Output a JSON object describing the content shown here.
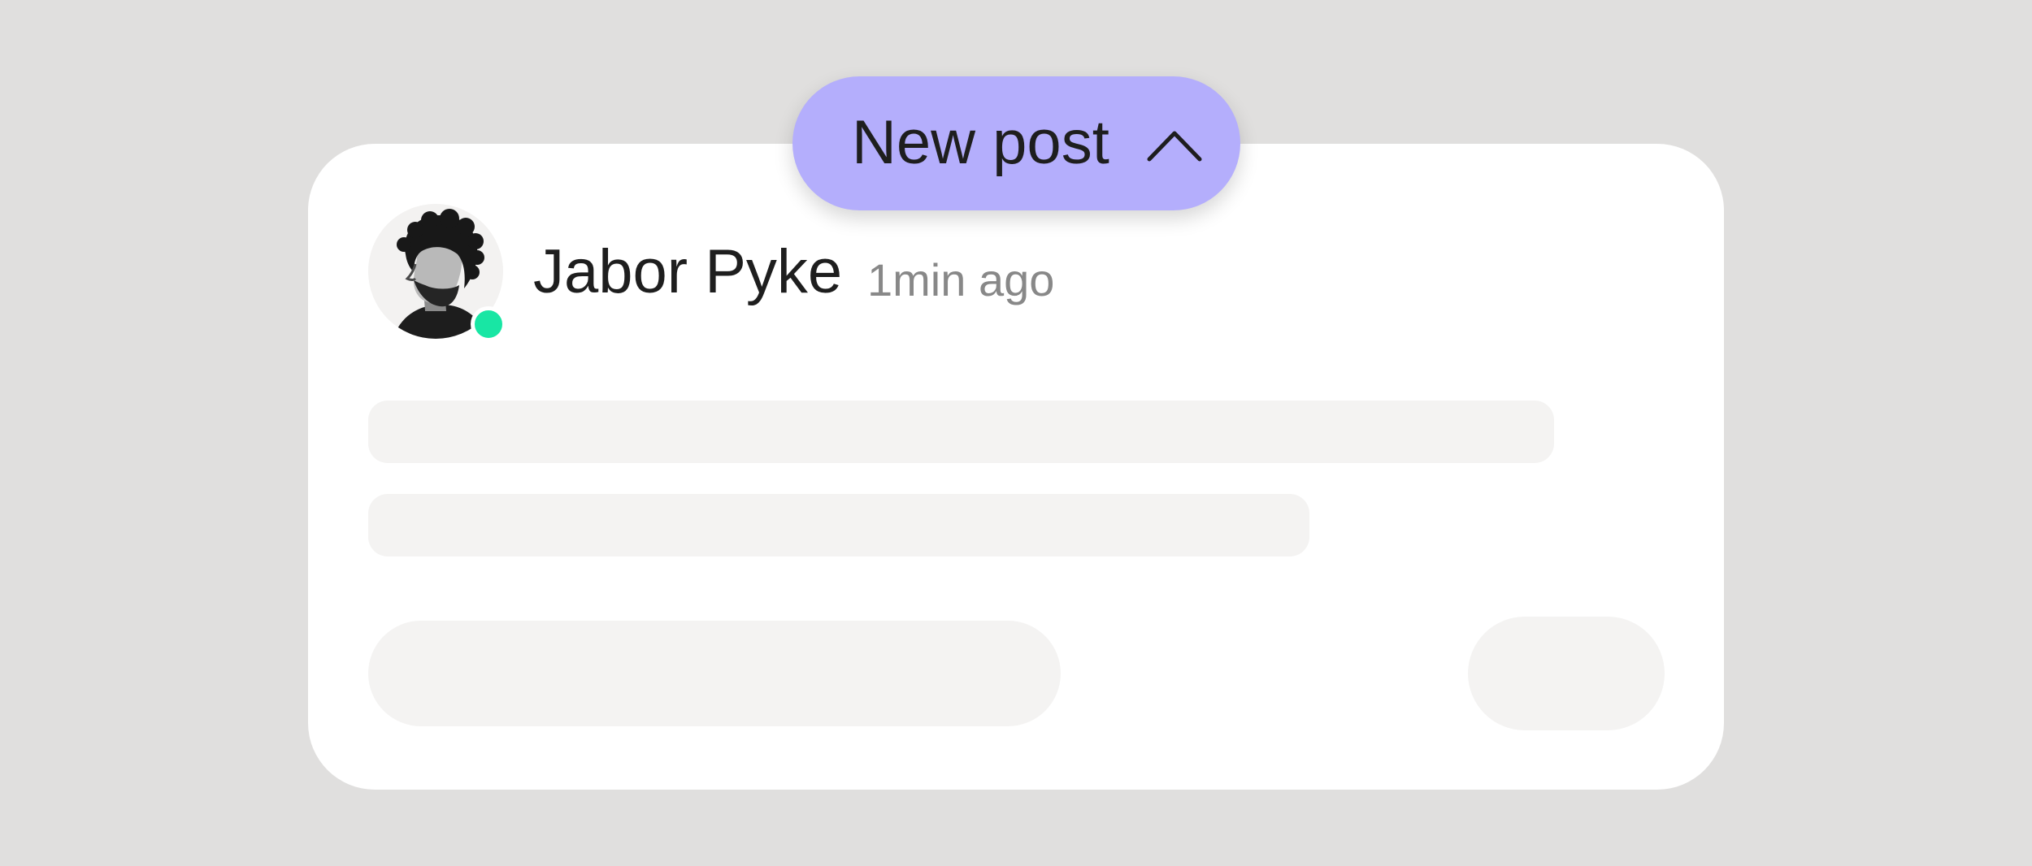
{
  "new_post": {
    "label": "New post",
    "icon": "chevron-up-icon"
  },
  "post": {
    "author": {
      "name": "Jabor Pyke",
      "avatar_icon": "avatar-portrait",
      "online": true
    },
    "time": "1min ago"
  },
  "colors": {
    "background": "#e0dfde",
    "card": "#ffffff",
    "accent": "#b4aefc",
    "online_status": "#18e6a4",
    "skeleton": "#f4f3f2",
    "primary_text": "#1e1e1e",
    "secondary_text": "#888888"
  }
}
